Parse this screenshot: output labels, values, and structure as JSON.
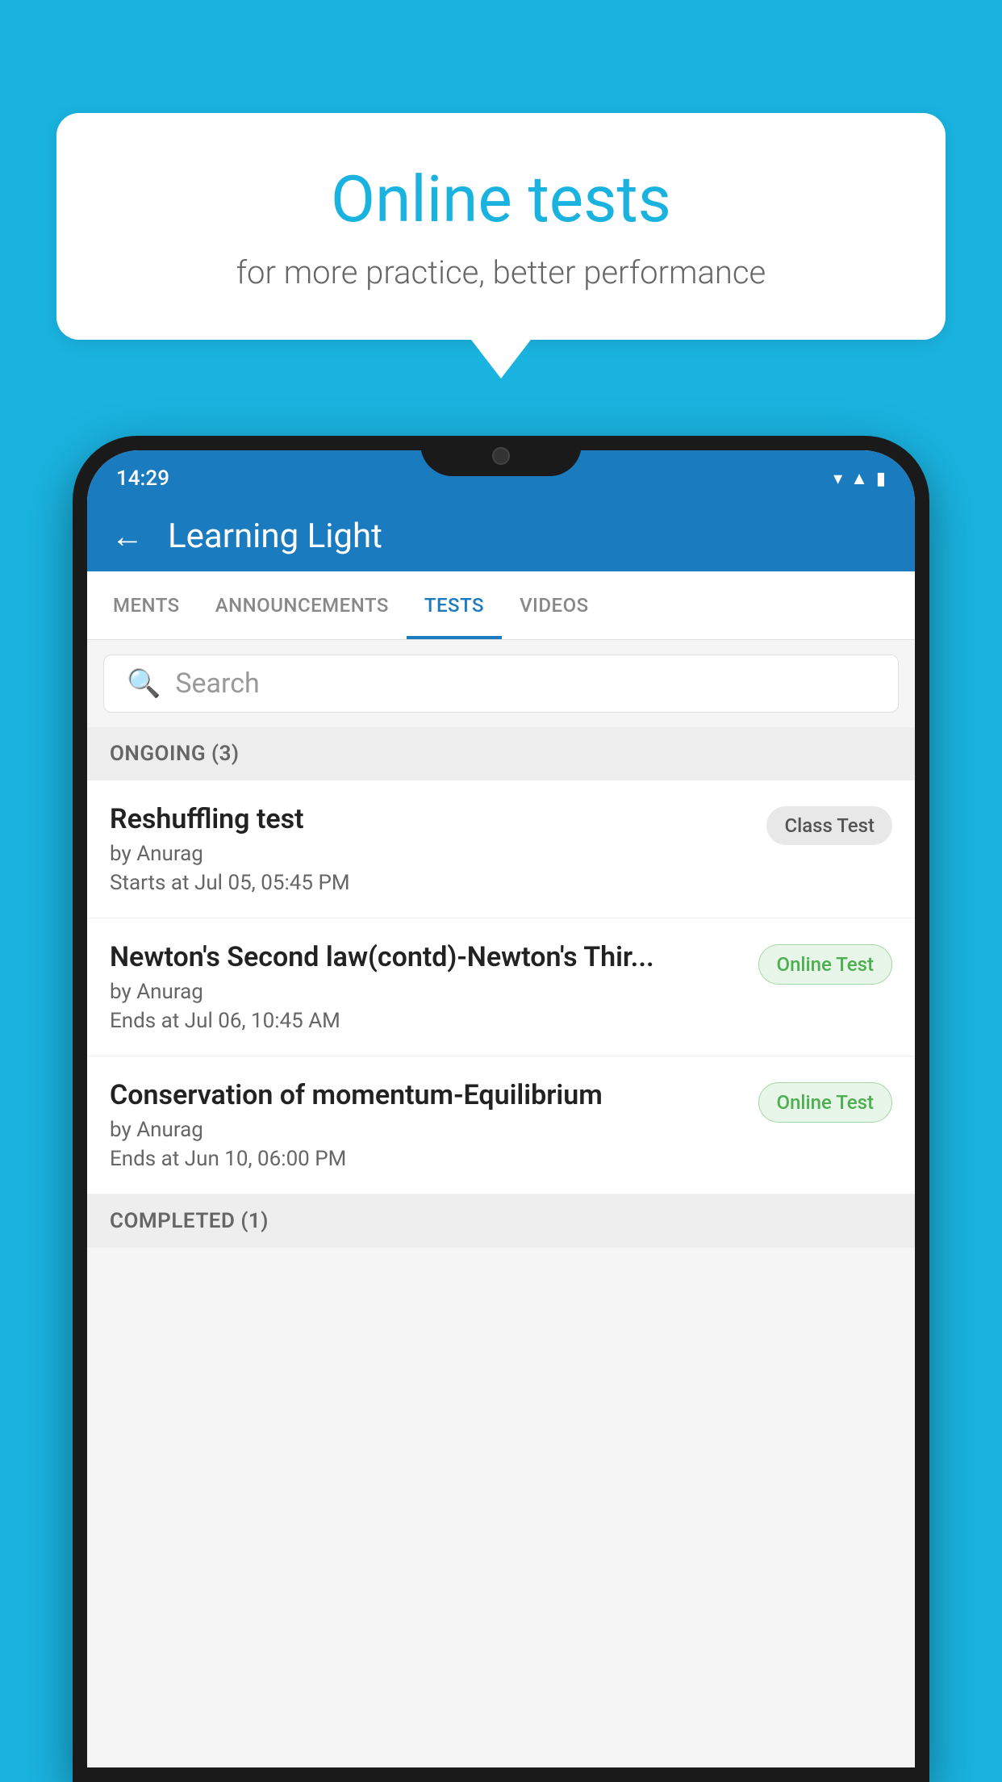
{
  "background": {
    "color": "#1ab3e0"
  },
  "speech_bubble": {
    "title": "Online tests",
    "subtitle": "for more practice, better performance"
  },
  "status_bar": {
    "time": "14:29",
    "icons": [
      "wifi",
      "signal",
      "battery"
    ]
  },
  "app_header": {
    "back_label": "←",
    "title": "Learning Light"
  },
  "tabs": [
    {
      "label": "MENTS",
      "active": false
    },
    {
      "label": "ANNOUNCEMENTS",
      "active": false
    },
    {
      "label": "TESTS",
      "active": true
    },
    {
      "label": "VIDEOS",
      "active": false
    }
  ],
  "search": {
    "placeholder": "Search"
  },
  "ongoing_section": {
    "label": "ONGOING (3)"
  },
  "tests": [
    {
      "title": "Reshuffling test",
      "author": "by Anurag",
      "date": "Starts at  Jul 05, 05:45 PM",
      "badge": "Class Test",
      "badge_type": "class"
    },
    {
      "title": "Newton's Second law(contd)-Newton's Thir...",
      "author": "by Anurag",
      "date": "Ends at  Jul 06, 10:45 AM",
      "badge": "Online Test",
      "badge_type": "online"
    },
    {
      "title": "Conservation of momentum-Equilibrium",
      "author": "by Anurag",
      "date": "Ends at  Jun 10, 06:00 PM",
      "badge": "Online Test",
      "badge_type": "online"
    }
  ],
  "completed_section": {
    "label": "COMPLETED (1)"
  }
}
